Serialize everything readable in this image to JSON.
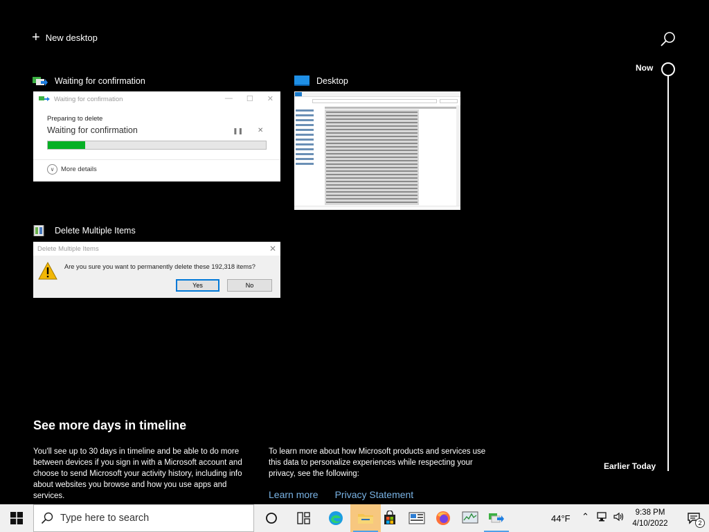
{
  "task_view": {
    "new_desktop_label": "New desktop",
    "timeline": {
      "now_label": "Now",
      "earlier_label": "Earlier Today"
    }
  },
  "windows": [
    {
      "title": "Waiting for confirmation",
      "icon": "file-move-icon",
      "content": {
        "header_title": "Waiting for confirmation",
        "preparing": "Preparing to delete",
        "status": "Waiting for confirmation",
        "progress": 0.17,
        "more_details": "More details"
      }
    },
    {
      "title": "Desktop",
      "icon": "desktop-icon"
    },
    {
      "title": "Delete Multiple Items",
      "icon": "recycle-bin-icon",
      "content": {
        "header_title": "Delete Multiple Items",
        "message": "Are you sure you want to permanently delete these 192,318 items?",
        "yes": "Yes",
        "no": "No"
      }
    }
  ],
  "info": {
    "heading": "See more days in timeline",
    "left": "You'll see up to 30 days in timeline and be able to do more between devices if you sign in with a Microsoft account and choose to send Microsoft your activity history, including info about websites you browse and how you use apps and services.",
    "right": "To learn more about how Microsoft products and services use this data to personalize experiences while respecting your privacy, see the following:",
    "learn_more": "Learn more",
    "privacy": "Privacy Statement"
  },
  "taskbar": {
    "search_placeholder": "Type here to search",
    "weather": "44°F",
    "time": "9:38 PM",
    "date": "4/10/2022",
    "notification_count": "2"
  },
  "colors": {
    "accent": "#0078d7",
    "progress": "#06b025",
    "link": "#7ab4e6"
  }
}
